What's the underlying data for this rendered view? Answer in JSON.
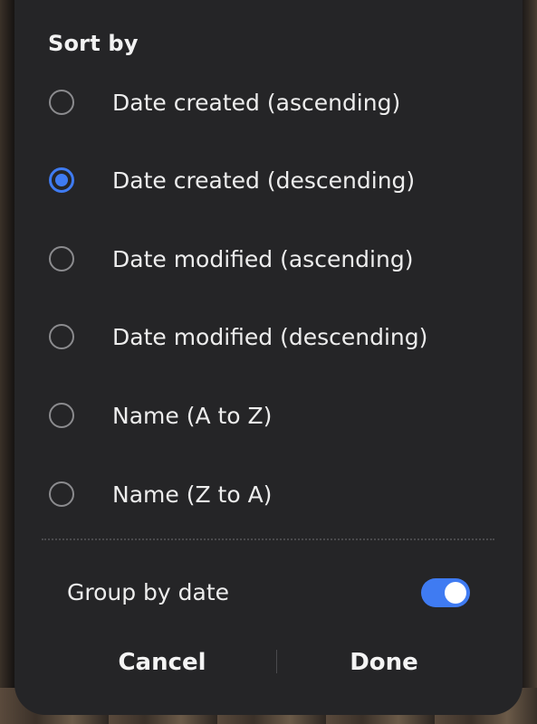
{
  "dialog": {
    "title": "Sort by",
    "options": [
      {
        "label": "Date created (ascending)",
        "selected": false
      },
      {
        "label": "Date created (descending)",
        "selected": true
      },
      {
        "label": "Date modified (ascending)",
        "selected": false
      },
      {
        "label": "Date modified (descending)",
        "selected": false
      },
      {
        "label": "Name (A to Z)",
        "selected": false
      },
      {
        "label": "Name (Z to A)",
        "selected": false
      }
    ],
    "group_by_date": {
      "label": "Group by date",
      "enabled": true
    },
    "actions": {
      "cancel_label": "Cancel",
      "done_label": "Done"
    }
  },
  "colors": {
    "accent": "#3f7bf2",
    "dialog_bg": "#252527",
    "text": "#ededed"
  }
}
